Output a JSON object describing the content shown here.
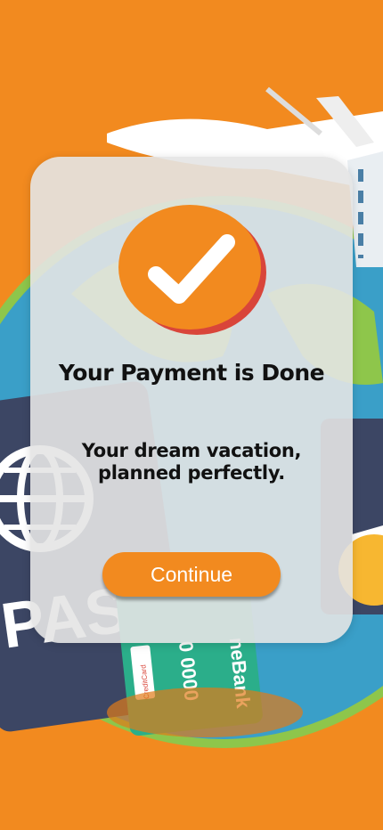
{
  "screen": {
    "title": "Your Payment is Done",
    "subtitle": "Your dream vacation, planned perfectly.",
    "continue_label": "Continue"
  },
  "background": {
    "passport_text": "PASS",
    "card_number_fragment": "0 0000",
    "card_bank_fragment": "neBank",
    "card_type": "CreditCard",
    "icons": [
      "airplane-icon",
      "globe-icon",
      "passport-icon",
      "credit-card-icon"
    ]
  },
  "success_icon": "checkmark-icon",
  "colors": {
    "background": "#f28a1f",
    "accent": "#f28a1f",
    "badge_shadow": "#d9453a",
    "card_surface": "#e4e4e4",
    "text": "#111111",
    "button_text": "#ffffff"
  }
}
